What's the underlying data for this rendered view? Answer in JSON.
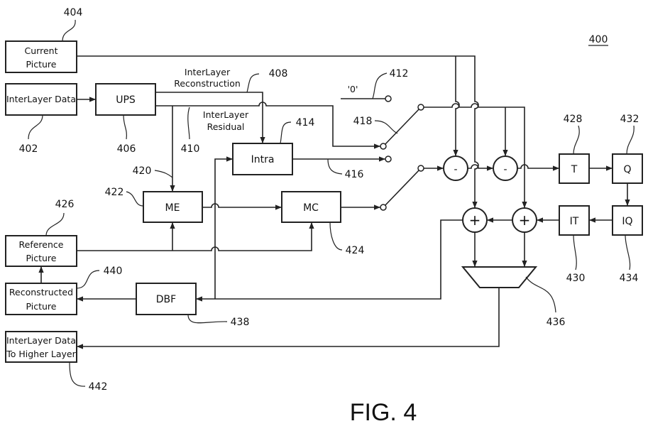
{
  "figure": {
    "caption": "FIG. 4",
    "ref": "400"
  },
  "blocks": {
    "current_picture": {
      "line1": "Current",
      "line2": "Picture",
      "ref": "404"
    },
    "interlayer_data": {
      "label": "InterLayer Data",
      "ref": "402"
    },
    "ups": {
      "label": "UPS",
      "ref": "406"
    },
    "intra": {
      "label": "Intra",
      "ref": "414"
    },
    "me": {
      "label": "ME",
      "ref": "422"
    },
    "mc": {
      "label": "MC",
      "ref": "424"
    },
    "reference_picture": {
      "line1": "Reference",
      "line2": "Picture",
      "ref": "426"
    },
    "reconstructed_picture": {
      "line1": "Reconstructed",
      "line2": "Picture",
      "ref": "440"
    },
    "dbf": {
      "label": "DBF",
      "ref": "438"
    },
    "interlayer_higher": {
      "line1": "InterLayer Data",
      "line2": "To Higher Layer",
      "ref": "442"
    },
    "t": {
      "label": "T",
      "ref": "428"
    },
    "q": {
      "label": "Q",
      "ref": "432"
    },
    "it": {
      "label": "IT",
      "ref": "430"
    },
    "iq": {
      "label": "IQ",
      "ref": "434"
    },
    "mux": {
      "ref": "436"
    }
  },
  "signals": {
    "reconstruction": {
      "line1": "InterLayer",
      "line2": "Reconstruction",
      "ref": "408"
    },
    "residual": {
      "line1": "InterLayer",
      "line2": "Residual",
      "ref": "410"
    },
    "zero": {
      "label": "'0'",
      "ref": "412"
    },
    "intra_out": {
      "ref": "416"
    },
    "switch": {
      "ref": "418"
    },
    "residual_to_me": {
      "ref": "420"
    }
  },
  "operators": {
    "sub": "-",
    "add": "+"
  }
}
